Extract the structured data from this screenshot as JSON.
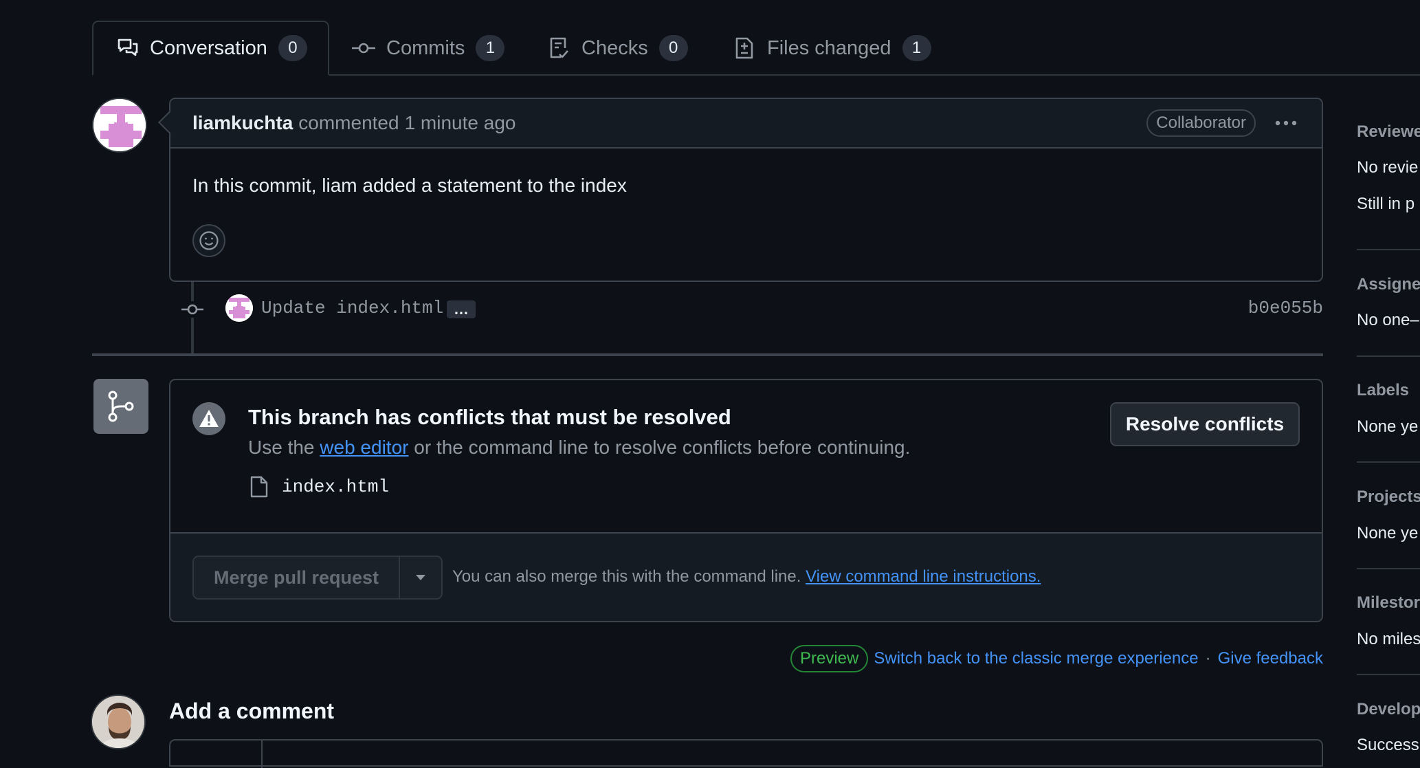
{
  "tabs": [
    {
      "label": "Conversation",
      "count": "0"
    },
    {
      "label": "Commits",
      "count": "1"
    },
    {
      "label": "Checks",
      "count": "0"
    },
    {
      "label": "Files changed",
      "count": "1"
    }
  ],
  "comment": {
    "author": "liamkuchta",
    "action": "commented",
    "time": "1 minute ago",
    "role_badge": "Collaborator",
    "body": "In this commit, liam added a statement to the index"
  },
  "commit": {
    "message": "Update index.html",
    "ellipsis": "…",
    "sha": "b0e055b"
  },
  "merge": {
    "title": "This branch has conflicts that must be resolved",
    "desc_prefix": "Use the",
    "desc_link": "web editor",
    "desc_suffix": "or the command line to resolve conflicts before continuing.",
    "conflict_file": "index.html",
    "resolve_button": "Resolve conflicts",
    "merge_button": "Merge pull request",
    "cli_text": "You can also merge this with the command line.",
    "cli_link": "View command line instructions."
  },
  "preview": {
    "badge": "Preview",
    "switch_link": "Switch back to the classic merge experience",
    "separator": "·",
    "feedback_link": "Give feedback"
  },
  "add_comment": {
    "heading": "Add a comment"
  },
  "sidebar": {
    "reviewers_label": "Reviewe",
    "reviewers_value": "No revie",
    "reviewers_value2": "Still in p",
    "assignees_label": "Assigne",
    "assignees_value": "No one–",
    "labels_label": "Labels",
    "labels_value": "None ye",
    "projects_label": "Projects",
    "projects_value": "None ye",
    "milestone_label": "Milestor",
    "milestone_value": "No miles",
    "development_label": "Develop",
    "development_value": "Success"
  },
  "colors": {
    "background": "#0d1117",
    "border": "#3d444d",
    "link": "#4493f8",
    "preview_green": "#3fb950",
    "avatar_pink": "#d98fd6"
  }
}
